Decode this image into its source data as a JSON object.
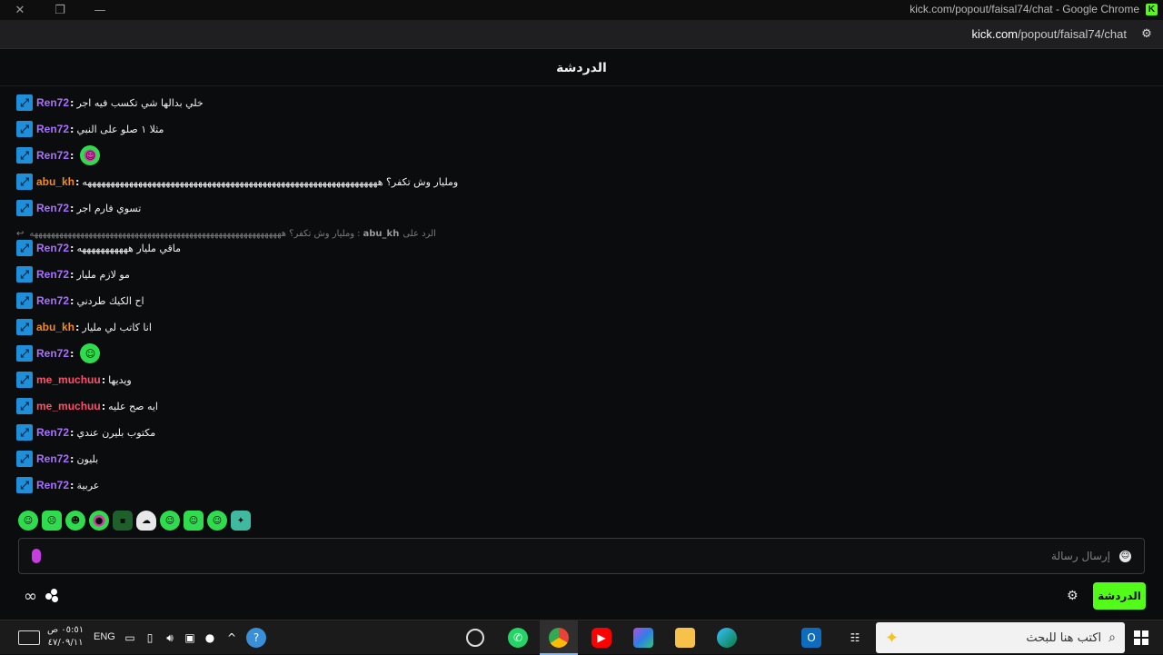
{
  "window": {
    "title": "kick.com/popout/faisal74/chat - Google Chrome",
    "brand_color": "#53fc18"
  },
  "urlbar": {
    "host": "kick.com",
    "path": "/popout/faisal74/chat"
  },
  "chat": {
    "title": "الدردشة",
    "messages": [
      {
        "user": "Ren72",
        "color": "purple",
        "text": "خلي بدالها شي تكسب فيه اجر"
      },
      {
        "user": "Ren72",
        "color": "purple",
        "text": "مثلا ١ صلو على النبي"
      },
      {
        "user": "Ren72",
        "color": "purple",
        "text": "",
        "emote": "green-emote"
      },
      {
        "user": "abu_kh",
        "color": "orange",
        "text": "ومليار وش تكفر؟ ههههههههههههههههههههههههههههههههههههههههههههههههههههههههههههههههه"
      },
      {
        "user": "Ren72",
        "color": "purple",
        "text": "تسوي فارم اجر"
      },
      {
        "user": "Ren72",
        "color": "purple",
        "text": "ماقي مليار هههههههههههه"
      },
      {
        "user": "Ren72",
        "color": "purple",
        "text": "مو لازم مليار"
      },
      {
        "user": "Ren72",
        "color": "purple",
        "text": "اح الكيك طردني"
      },
      {
        "user": "abu_kh",
        "color": "orange",
        "text": "انا كاتب لي مليار"
      },
      {
        "user": "Ren72",
        "color": "purple",
        "text": "",
        "emote": "green-emote"
      },
      {
        "user": "me_muchuu",
        "color": "red",
        "text": "ويديها"
      },
      {
        "user": "me_muchuu",
        "color": "red",
        "text": "ايه صح عليه"
      },
      {
        "user": "Ren72",
        "color": "purple",
        "text": "مكتوب بليرن عندي"
      },
      {
        "user": "Ren72",
        "color": "purple",
        "text": "بليون"
      },
      {
        "user": "Ren72",
        "color": "purple",
        "text": "عربية"
      }
    ],
    "reply": {
      "label": "الرد على",
      "user": "abu_kh",
      "text": "ومليار وش تكفر؟ ههههههههههههههههههههههههههههههههههههههههههههههههههههههههههههه"
    },
    "input_placeholder": "إرسال رسالة",
    "chat_button": "الدردشة"
  },
  "taskbar": {
    "search_placeholder": "اكتب هنا للبحث",
    "lang": "ENG",
    "time": "٠٥:٥١ ص",
    "date": "٤٧/٠٩/١١"
  }
}
